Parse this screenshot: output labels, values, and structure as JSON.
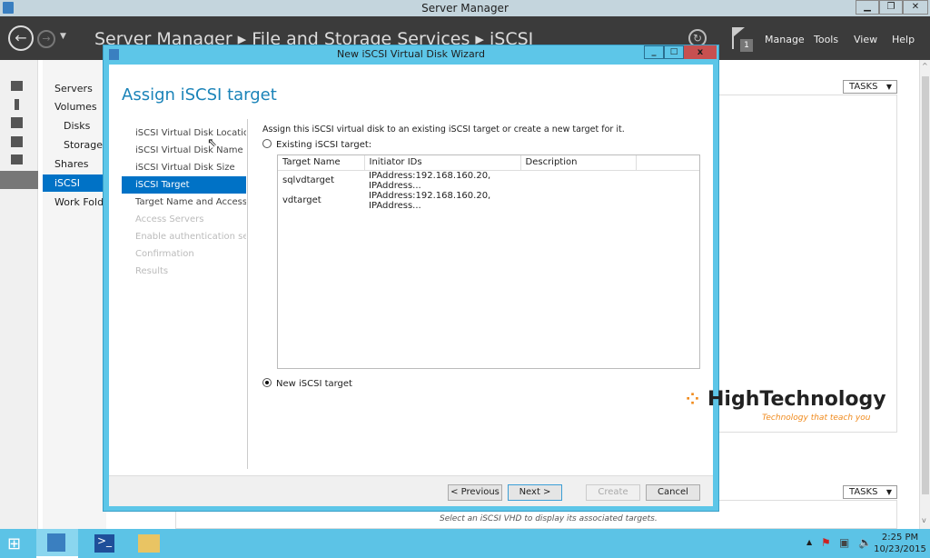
{
  "window": {
    "title": "Server Manager"
  },
  "header": {
    "breadcrumb": "Server Manager  ▸  File and Storage Services  ▸  iSCSI",
    "flag_count": "1",
    "menus": [
      "Manage",
      "Tools",
      "View",
      "Help"
    ]
  },
  "nav": {
    "items": [
      "Servers",
      "Volumes",
      "Disks",
      "Storage",
      "Shares",
      "iSCSI",
      "Work Fold"
    ],
    "selected": "iSCSI"
  },
  "main": {
    "tasks_label": "TASKS",
    "bottom_hint": "Select an iSCSI VHD to display its associated targets."
  },
  "dialog": {
    "title": "New iSCSI Virtual Disk Wizard",
    "heading": "Assign iSCSI target",
    "steps": [
      {
        "label": "iSCSI Virtual Disk Location",
        "state": "done"
      },
      {
        "label": "iSCSI Virtual Disk Name",
        "state": "done"
      },
      {
        "label": "iSCSI Virtual Disk Size",
        "state": "done"
      },
      {
        "label": "iSCSI Target",
        "state": "current"
      },
      {
        "label": "Target Name and Access",
        "state": "enabled"
      },
      {
        "label": "Access Servers",
        "state": "disabled"
      },
      {
        "label": "Enable authentication ser...",
        "state": "disabled"
      },
      {
        "label": "Confirmation",
        "state": "disabled"
      },
      {
        "label": "Results",
        "state": "disabled"
      }
    ],
    "instruction": "Assign this iSCSI virtual disk to an existing iSCSI target or create a new target for it.",
    "existing_label": "Existing iSCSI target:",
    "new_label": "New iSCSI target",
    "selected_option": "new",
    "table": {
      "columns": [
        "Target Name",
        "Initiator IDs",
        "Description"
      ],
      "rows": [
        [
          "sqlvdtarget",
          "IPAddress:192.168.160.20, IPAddress...",
          ""
        ],
        [
          "vdtarget",
          "IPAddress:192.168.160.20, IPAddress...",
          ""
        ]
      ]
    },
    "buttons": {
      "previous": "< Previous",
      "next": "Next >",
      "create": "Create",
      "cancel": "Cancel"
    }
  },
  "watermark": {
    "brand": "HighTechnology",
    "tagline": "Technology that teach you"
  },
  "taskbar": {
    "time": "2:25 PM",
    "date": "10/23/2015"
  },
  "colors": {
    "accent": "#0072c6",
    "dialog_frame": "#5dc6e8",
    "taskbar": "#5cc3e6",
    "close": "#c75050"
  }
}
